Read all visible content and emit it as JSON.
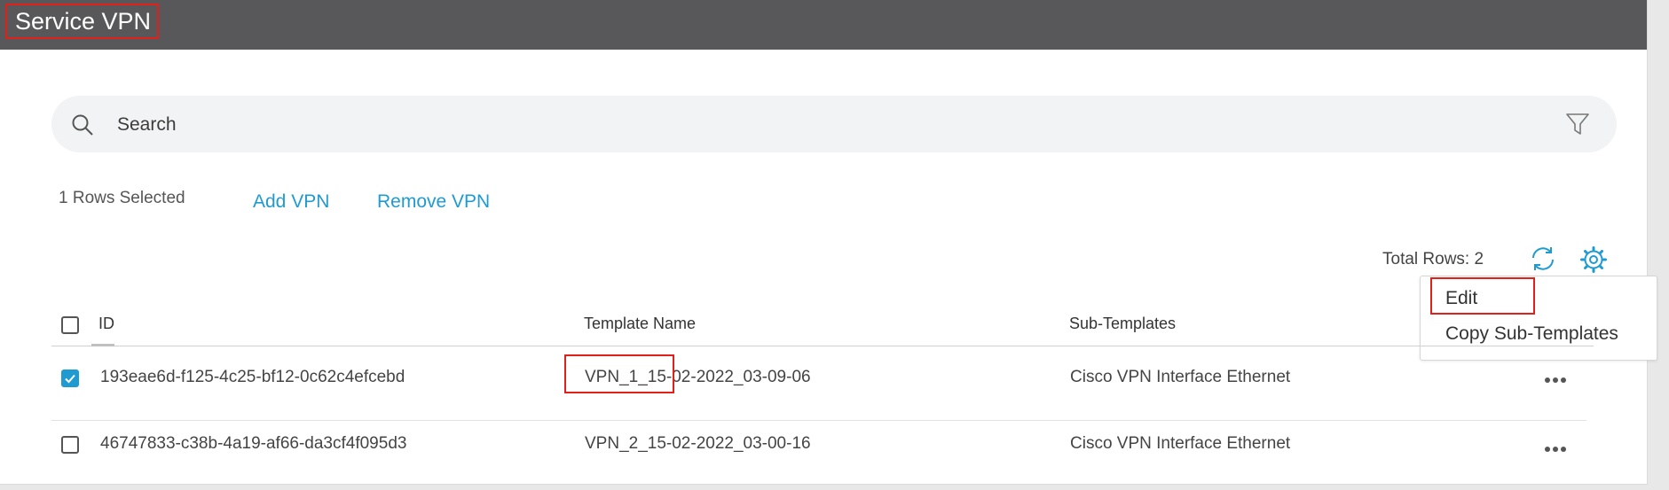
{
  "header": {
    "title": "Service VPN"
  },
  "search": {
    "placeholder": "Search"
  },
  "toolbar": {
    "selected_text": "1 Rows Selected",
    "add_label": "Add VPN",
    "remove_label": "Remove VPN",
    "total_rows": "Total Rows: 2"
  },
  "menu": {
    "items": [
      "Edit",
      "Copy Sub-Templates"
    ]
  },
  "table": {
    "columns": [
      "ID",
      "Template Name",
      "Sub-Templates"
    ],
    "rows": [
      {
        "id": "193eae6d-f125-4c25-bf12-0c62c4efcebd",
        "template_name": "VPN_1_15-02-2022_03-09-06",
        "sub_templates": "Cisco VPN Interface Ethernet",
        "selected": true
      },
      {
        "id": "46747833-c38b-4a19-af66-da3cf4f095d3",
        "template_name": "VPN_2_15-02-2022_03-00-16",
        "sub_templates": "Cisco VPN Interface Ethernet",
        "selected": false
      }
    ]
  },
  "colors": {
    "header_bg": "#58585a",
    "accent": "#1f9bd1",
    "highlight_box": "#e0201b"
  }
}
